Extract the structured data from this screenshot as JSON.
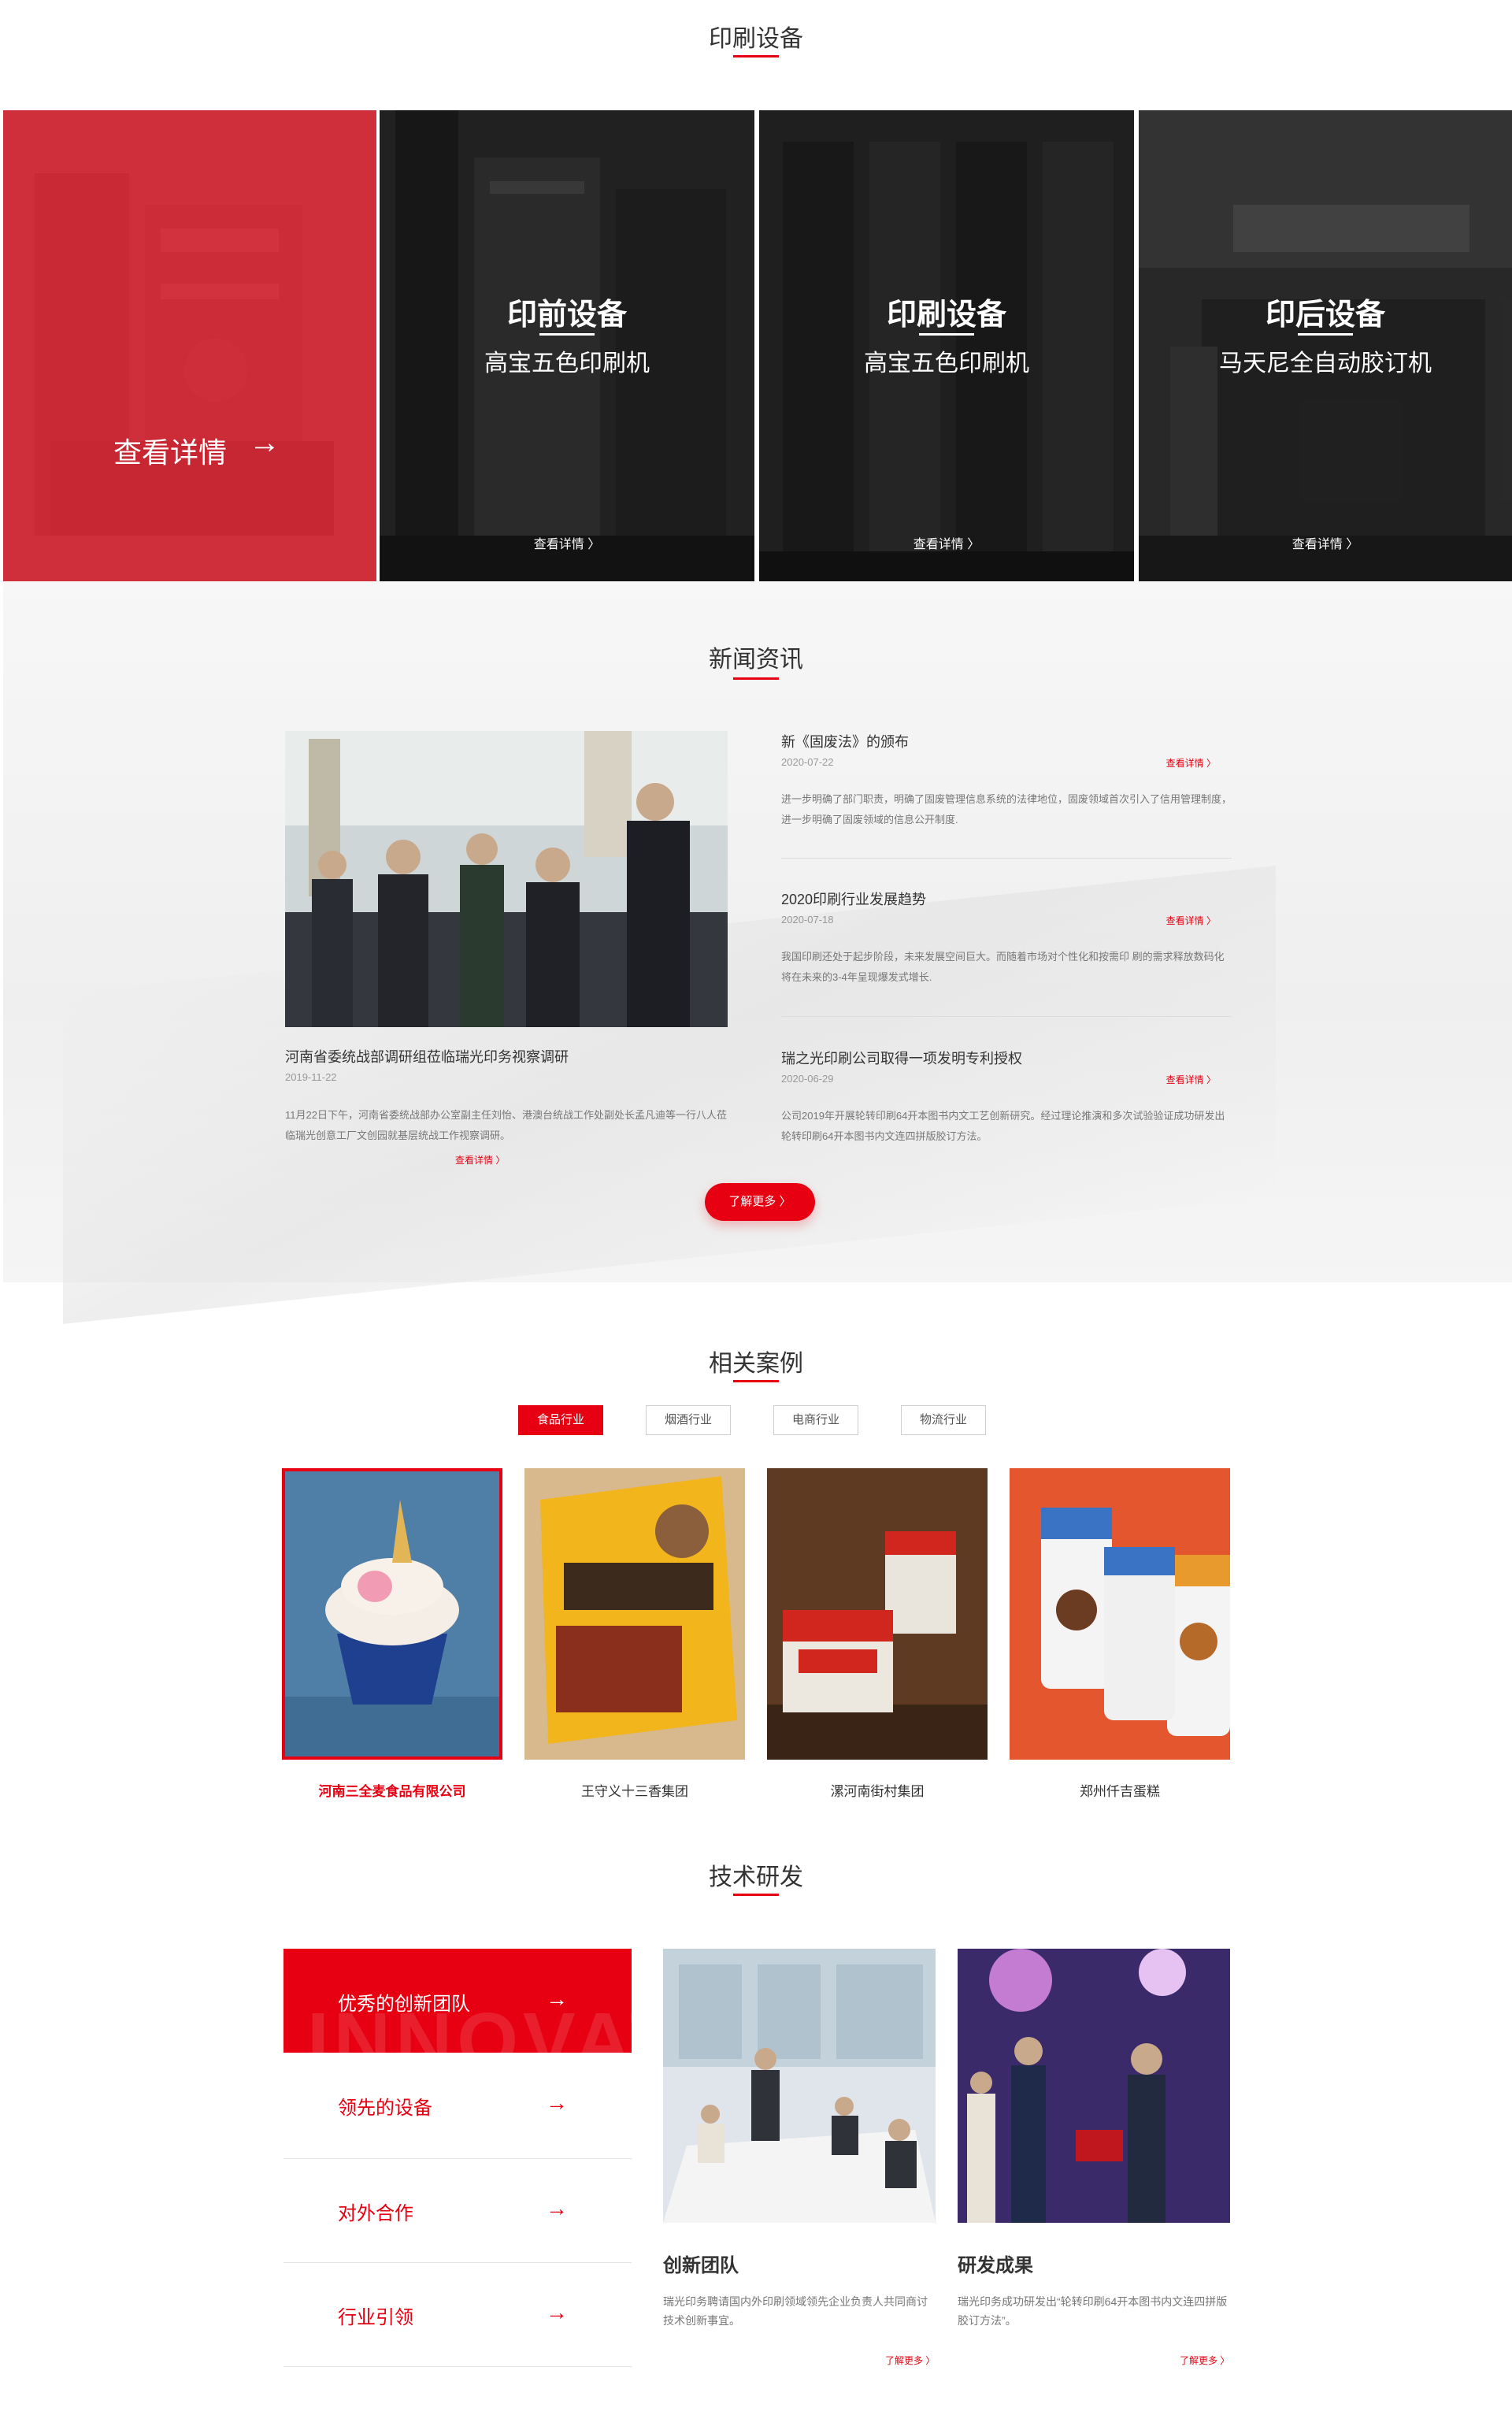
{
  "equipment": {
    "title": "印刷设备",
    "featured": {
      "label": "查看详情",
      "arrow": "→"
    },
    "items": [
      {
        "category": "印前设备",
        "name": "高宝五色印刷机",
        "more": "查看详情 〉"
      },
      {
        "category": "印刷设备",
        "name": "高宝五色印刷机",
        "more": "查看详情 〉"
      },
      {
        "category": "印后设备",
        "name": "马天尼全自动胶订机",
        "more": "查看详情 〉"
      }
    ]
  },
  "news": {
    "title": "新闻资讯",
    "main": {
      "title": "河南省委统战部调研组莅临瑞光印务视察调研",
      "date": "2019-11-22",
      "desc": "11月22日下午，河南省委统战部办公室副主任刘怡、港澳台统战工作处副处长孟凡迪等一行八人莅临瑞光创意工厂文创园就基层统战工作视察调研。",
      "more": "查看详情 〉"
    },
    "items": [
      {
        "title": "新《固废法》的颁布",
        "date": "2020-07-22",
        "more": "查看详情 〉",
        "desc": "进一步明确了部门职责，明确了固废管理信息系统的法律地位，固废领域首次引入了信用管理制度，进一步明确了固废领域的信息公开制度."
      },
      {
        "title": "2020印刷行业发展趋势",
        "date": "2020-07-18",
        "more": "查看详情 〉",
        "desc": "我国印刷还处于起步阶段，未来发展空间巨大。而随着市场对个性化和按需印 刷的需求释放数码化将在未来的3-4年呈现爆发式增长."
      },
      {
        "title": "瑞之光印刷公司取得一项发明专利授权",
        "date": "2020-06-29",
        "more": "查看详情 〉",
        "desc": "公司2019年开展轮转印刷64开本图书内文工艺创新研究。经过理论推演和多次试验验证成功研发出轮转印刷64开本图书内文连四拼版胶订方法。"
      }
    ],
    "more_button": "了解更多 〉"
  },
  "cases": {
    "title": "相关案例",
    "tabs": [
      "食品行业",
      "烟酒行业",
      "电商行业",
      "物流行业"
    ],
    "active_tab": "食品行业",
    "items": [
      {
        "name": "河南三全麦食品有限公司"
      },
      {
        "name": "王守义十三香集团"
      },
      {
        "name": "漯河南街村集团"
      },
      {
        "name": "郑州仟吉蛋糕"
      }
    ]
  },
  "tech": {
    "title": "技术研发",
    "menu": [
      {
        "label": "优秀的创新团队",
        "arrow": "→"
      },
      {
        "label": "领先的设备",
        "arrow": "→"
      },
      {
        "label": "对外合作",
        "arrow": "→"
      },
      {
        "label": "行业引领",
        "arrow": "→"
      }
    ],
    "watermark": "INNOVAT",
    "cards": [
      {
        "title": "创新团队",
        "desc": "瑞光印务聘请国内外印刷领域领先企业负责人共同商讨技术创新事宜。",
        "more": "了解更多 〉"
      },
      {
        "title": "研发成果",
        "desc": "瑞光印务成功研发出“轮转印刷64开本图书内文连四拼版胶订方法”。",
        "more": "了解更多 〉"
      }
    ]
  },
  "colors": {
    "accent": "#e60012",
    "featured_overlay": "#e82634"
  }
}
